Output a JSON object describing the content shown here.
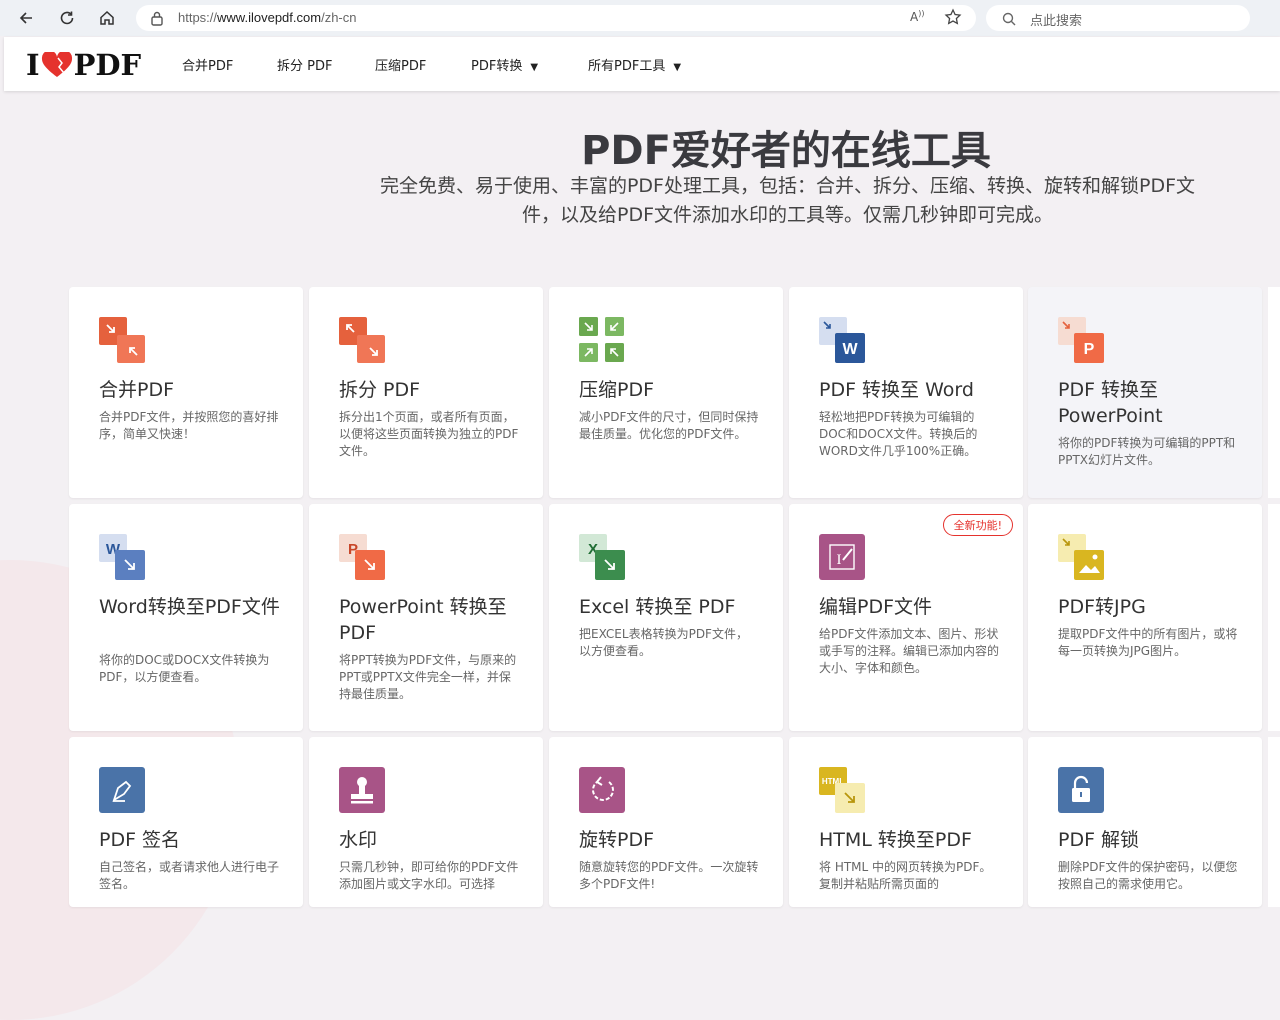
{
  "browser": {
    "url_prefix": "https://",
    "url_host": "www.ilovepdf.com",
    "url_path": "/zh-cn",
    "search_placeholder": "点此搜索",
    "reader_label": "A)"
  },
  "site": {
    "logo_left": "I",
    "logo_right": "PDF",
    "nav": [
      "合并PDF",
      "拆分 PDF",
      "压缩PDF",
      "PDF转换",
      "所有PDF工具"
    ]
  },
  "hero": {
    "title": "PDF爱好者的在线工具",
    "subtitle_line1": "完全免费、易于使用、丰富的PDF处理工具，包括：合并、拆分、压缩、转换、旋转和解锁PDF文",
    "subtitle_line2": "件，以及给PDF文件添加水印的工具等。仅需几秒钟即可完成。"
  },
  "tools": [
    {
      "title": "合并PDF",
      "desc": "合并PDF文件，并按照您的喜好排序，简单又快速！"
    },
    {
      "title": "拆分 PDF",
      "desc": "拆分出1个页面，或者所有页面，以便将这些页面转换为独立的PDF文件。"
    },
    {
      "title": "压缩PDF",
      "desc": "减小PDF文件的尺寸，但同时保持最佳质量。优化您的PDF文件。"
    },
    {
      "title": "PDF 转换至 Word",
      "desc": "轻松地把PDF转换为可编辑的DOC和DOCX文件。转换后的WORD文件几乎100%正确。"
    },
    {
      "title": "PDF 转换至 PowerPoint",
      "desc": "将你的PDF转换为可编辑的PPT和PPTX幻灯片文件。"
    },
    {
      "title": "Word转换至PDF文件",
      "desc": "将你的DOC或DOCX文件转换为PDF，以方便查看。"
    },
    {
      "title": "PowerPoint 转换至PDF",
      "desc": "将PPT转换为PDF文件，与原来的PPT或PPTX文件完全一样，并保持最佳质量。"
    },
    {
      "title": "Excel 转换至 PDF",
      "desc": "把EXCEL表格转换为PDF文件，以方便查看。"
    },
    {
      "title": "编辑PDF文件",
      "desc": "给PDF文件添加文本、图片、形状或手写的注释。编辑已添加内容的大小、字体和颜色。",
      "badge": "全新功能!"
    },
    {
      "title": "PDF转JPG",
      "desc": "提取PDF文件中的所有图片，或将每一页转换为JPG图片。"
    },
    {
      "title": "PDF 签名",
      "desc": "自己签名，或者请求他人进行电子签名。"
    },
    {
      "title": "水印",
      "desc": "只需几秒钟，即可给你的PDF文件添加图片或文字水印。可选择"
    },
    {
      "title": "旋转PDF",
      "desc": "随意旋转您的PDF文件。一次旋转多个PDF文件!"
    },
    {
      "title": "HTML 转换至PDF",
      "desc": "将 HTML 中的网页转换为PDF。复制并粘贴所需页面的"
    },
    {
      "title": "PDF 解锁",
      "desc": "删除PDF文件的保护密码，以便您按照自己的需求使用它。"
    }
  ],
  "colors": {
    "accent": "#e5322d",
    "merge": "#e5613d",
    "compress": "#6aa84f",
    "word": "#2b579a",
    "ppt": "#f06a46",
    "excel": "#3c8d4e",
    "edit": "#a85487",
    "jpg": "#d9b620",
    "sign": "#4a73a8",
    "html": "#d9b620"
  }
}
